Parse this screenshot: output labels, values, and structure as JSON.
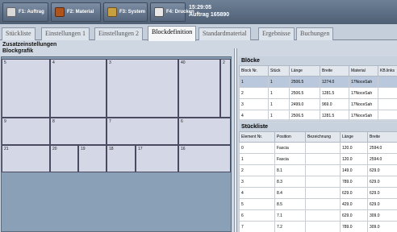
{
  "toolbar": {
    "buttons": [
      {
        "label": "F1: Auftrag",
        "icon": "folder-icon"
      },
      {
        "label": "F2: Material",
        "icon": "box-icon"
      },
      {
        "label": "F3: System",
        "icon": "tools-icon"
      },
      {
        "label": "F4: Drucken",
        "icon": "printer-icon"
      }
    ],
    "time": "15:29:05",
    "order": "Auftrag 165890"
  },
  "tabs": [
    "Stückliste",
    "Einstellungen 1",
    "Einstellungen 2",
    "Blockdefinition",
    "Standardmaterial",
    "Ergebnisse",
    "Buchungen"
  ],
  "active_tab": "Blockdefinition",
  "section_title": "Zusatzeinstellungen",
  "blockgrafik": {
    "title": "Blockgrafik",
    "blocks": [
      "5",
      "4",
      "3",
      "40",
      "2",
      "9",
      "8",
      "7",
      "6",
      "21",
      "20",
      "19",
      "18",
      "17",
      "16"
    ]
  },
  "bloecke": {
    "title": "Blöcke",
    "columns": [
      "Block Nr.",
      "Stück",
      "Länge",
      "Breite",
      "Material",
      "KB.links"
    ],
    "rows": [
      [
        "1",
        "1",
        "2506.5",
        "1274.0",
        "17NoceSah",
        ""
      ],
      [
        "2",
        "1",
        "2506.5",
        "1281.5",
        "17NoceSah",
        ""
      ],
      [
        "3",
        "1",
        "2499.0",
        "969.0",
        "17NoceSah",
        ""
      ],
      [
        "4",
        "1",
        "2506.5",
        "1281.5",
        "17NoceSah",
        ""
      ]
    ]
  },
  "stueckliste": {
    "title": "Stückliste",
    "columns": [
      "Element Nr.",
      "Position",
      "Bezeichnung",
      "Länge",
      "Breite"
    ],
    "rows": [
      [
        "0",
        "Fascia",
        "",
        "120.0",
        "2594.0"
      ],
      [
        "1",
        "Fascia",
        "",
        "120.0",
        "2594.0"
      ],
      [
        "2",
        "8.1",
        "",
        "149.0",
        "629.0"
      ],
      [
        "3",
        "8.3",
        "",
        "789.0",
        "629.0"
      ],
      [
        "4",
        "8.4",
        "",
        "629.0",
        "629.0"
      ],
      [
        "5",
        "8.5",
        "",
        "429.0",
        "629.0"
      ],
      [
        "6",
        "7.1",
        "",
        "629.0",
        "309.0"
      ],
      [
        "7",
        "7.2",
        "",
        "789.0",
        "309.0"
      ]
    ]
  }
}
